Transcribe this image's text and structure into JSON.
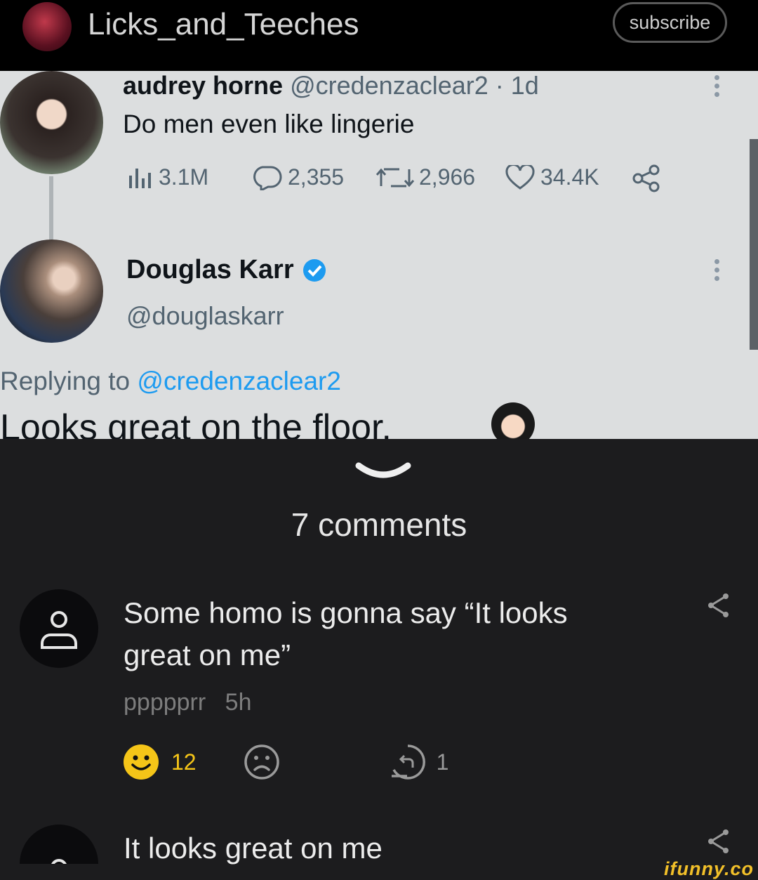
{
  "header": {
    "channel_name": "Licks_and_Teeches",
    "subscribe_label": "subscribe"
  },
  "tweet": {
    "author1_name": "audrey horne",
    "author1_handle": "@credenzaclear2 · 1d",
    "author1_text": "Do men even like lingerie",
    "stats": {
      "views": "3.1M",
      "replies": "2,355",
      "retweets": "2,966",
      "likes": "34.4K"
    },
    "author2_name": "Douglas Karr",
    "author2_handle": "@douglaskarr",
    "replying_prefix": "Replying to",
    "replying_handle": "@credenzaclear2",
    "reply_text": "Looks great on the floor."
  },
  "comments_section": {
    "title": "7 comments",
    "comments": [
      {
        "text": "Some homo is gonna say “It looks great on me”",
        "user": "ppppprr",
        "time": "5h",
        "smile_count": "12",
        "reply_count": "1"
      },
      {
        "text": "It looks great on me"
      }
    ]
  },
  "watermark": "ifunny.co",
  "colors": {
    "accent_blue": "#1d9bf0",
    "smile_yellow": "#f5c518",
    "background": "#1c1c1e"
  }
}
